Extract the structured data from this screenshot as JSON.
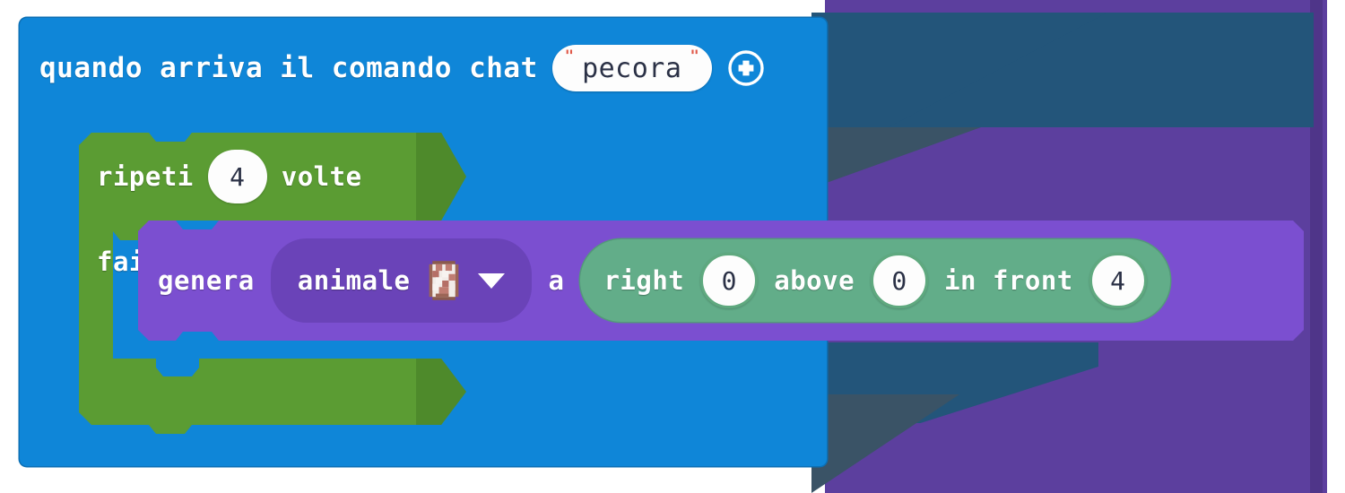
{
  "event_block": {
    "label": "quando arriva il comando chat",
    "command_field": {
      "value": "pecora",
      "quote_open": "\"",
      "quote_close": "\""
    },
    "add_button_icon": "plus-circle-icon"
  },
  "loop_block": {
    "repeat_label": "ripeti",
    "times_value": "4",
    "times_label": "volte",
    "do_label": "fai"
  },
  "spawn_block": {
    "verb_label": "genera",
    "entity_dropdown": {
      "label": "animale",
      "icon": "sheep-sprite-icon",
      "caret": "chevron-down-icon"
    },
    "at_label": "a"
  },
  "coordinate_block": {
    "right_label": "right",
    "right_value": "0",
    "above_label": "above",
    "above_value": "0",
    "front_label": "in front",
    "front_value": "4"
  },
  "colors": {
    "event_blue": "#0f86d8",
    "loop_green": "#5b9c33",
    "spawn_purple": "#7b4fd0",
    "dropdown_purple": "#6a43b8",
    "coord_green": "#62ad89",
    "field_white": "#fdfdfd",
    "quote_red": "#e05a4a",
    "background_purple": "#5c3f9e",
    "shadow_teal": "#23557a",
    "shadow_slate": "#3a5366"
  }
}
